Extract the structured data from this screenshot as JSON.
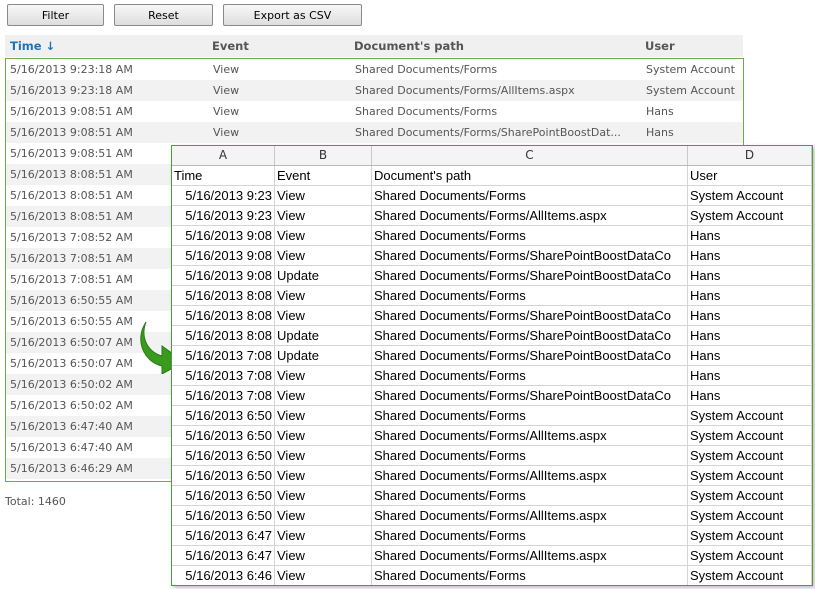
{
  "toolbar": {
    "filter_label": "Filter",
    "reset_label": "Reset",
    "export_label": "Export as CSV"
  },
  "log": {
    "headers": {
      "time": "Time ↓",
      "event": "Event",
      "path": "Document's path",
      "user": "User"
    },
    "rows": [
      {
        "time": "5/16/2013 9:23:18 AM",
        "event": "View",
        "path": "Shared Documents/Forms",
        "user": "System Account"
      },
      {
        "time": "5/16/2013 9:23:18 AM",
        "event": "View",
        "path": "Shared Documents/Forms/AllItems.aspx",
        "user": "System Account"
      },
      {
        "time": "5/16/2013 9:08:51 AM",
        "event": "View",
        "path": "Shared Documents/Forms",
        "user": "Hans"
      },
      {
        "time": "5/16/2013 9:08:51 AM",
        "event": "View",
        "path": "Shared Documents/Forms/SharePointBoostDat...",
        "user": "Hans"
      },
      {
        "time": "5/16/2013 9:08:51 AM",
        "event": "",
        "path": "",
        "user": ""
      },
      {
        "time": "5/16/2013 8:08:51 AM",
        "event": "",
        "path": "",
        "user": ""
      },
      {
        "time": "5/16/2013 8:08:51 AM",
        "event": "",
        "path": "",
        "user": ""
      },
      {
        "time": "5/16/2013 8:08:51 AM",
        "event": "",
        "path": "",
        "user": ""
      },
      {
        "time": "5/16/2013 7:08:52 AM",
        "event": "",
        "path": "",
        "user": ""
      },
      {
        "time": "5/16/2013 7:08:51 AM",
        "event": "",
        "path": "",
        "user": ""
      },
      {
        "time": "5/16/2013 7:08:51 AM",
        "event": "",
        "path": "",
        "user": ""
      },
      {
        "time": "5/16/2013 6:50:55 AM",
        "event": "",
        "path": "",
        "user": ""
      },
      {
        "time": "5/16/2013 6:50:55 AM",
        "event": "",
        "path": "",
        "user": ""
      },
      {
        "time": "5/16/2013 6:50:07 AM",
        "event": "",
        "path": "",
        "user": ""
      },
      {
        "time": "5/16/2013 6:50:07 AM",
        "event": "",
        "path": "",
        "user": ""
      },
      {
        "time": "5/16/2013 6:50:02 AM",
        "event": "",
        "path": "",
        "user": ""
      },
      {
        "time": "5/16/2013 6:50:02 AM",
        "event": "",
        "path": "",
        "user": ""
      },
      {
        "time": "5/16/2013 6:47:40 AM",
        "event": "",
        "path": "",
        "user": ""
      },
      {
        "time": "5/16/2013 6:47:40 AM",
        "event": "",
        "path": "",
        "user": ""
      },
      {
        "time": "5/16/2013 6:46:29 AM",
        "event": "",
        "path": "",
        "user": ""
      }
    ],
    "total_text": "Total: 1460"
  },
  "arrow_icon": "curved-arrow-icon",
  "arrow_color": "#3a9a1e",
  "spreadsheet": {
    "columns": [
      "A",
      "B",
      "C",
      "D"
    ],
    "header": {
      "time": "Time",
      "event": "Event",
      "path": "Document's path",
      "user": "User"
    },
    "rows": [
      {
        "time": "5/16/2013 9:23",
        "event": "View",
        "path": "Shared Documents/Forms",
        "user": "System Account"
      },
      {
        "time": "5/16/2013 9:23",
        "event": "View",
        "path": "Shared Documents/Forms/AllItems.aspx",
        "user": "System Account"
      },
      {
        "time": "5/16/2013 9:08",
        "event": "View",
        "path": "Shared Documents/Forms",
        "user": "Hans"
      },
      {
        "time": "5/16/2013 9:08",
        "event": "View",
        "path": "Shared Documents/Forms/SharePointBoostDataCo",
        "user": "Hans"
      },
      {
        "time": "5/16/2013 9:08",
        "event": "Update",
        "path": "Shared Documents/Forms/SharePointBoostDataCo",
        "user": "Hans"
      },
      {
        "time": "5/16/2013 8:08",
        "event": "View",
        "path": "Shared Documents/Forms",
        "user": "Hans"
      },
      {
        "time": "5/16/2013 8:08",
        "event": "View",
        "path": "Shared Documents/Forms/SharePointBoostDataCo",
        "user": "Hans"
      },
      {
        "time": "5/16/2013 8:08",
        "event": "Update",
        "path": "Shared Documents/Forms/SharePointBoostDataCo",
        "user": "Hans"
      },
      {
        "time": "5/16/2013 7:08",
        "event": "Update",
        "path": "Shared Documents/Forms/SharePointBoostDataCo",
        "user": "Hans"
      },
      {
        "time": "5/16/2013 7:08",
        "event": "View",
        "path": "Shared Documents/Forms",
        "user": "Hans"
      },
      {
        "time": "5/16/2013 7:08",
        "event": "View",
        "path": "Shared Documents/Forms/SharePointBoostDataCo",
        "user": "Hans"
      },
      {
        "time": "5/16/2013 6:50",
        "event": "View",
        "path": "Shared Documents/Forms",
        "user": "System Account"
      },
      {
        "time": "5/16/2013 6:50",
        "event": "View",
        "path": "Shared Documents/Forms/AllItems.aspx",
        "user": "System Account"
      },
      {
        "time": "5/16/2013 6:50",
        "event": "View",
        "path": "Shared Documents/Forms",
        "user": "System Account"
      },
      {
        "time": "5/16/2013 6:50",
        "event": "View",
        "path": "Shared Documents/Forms/AllItems.aspx",
        "user": "System Account"
      },
      {
        "time": "5/16/2013 6:50",
        "event": "View",
        "path": "Shared Documents/Forms",
        "user": "System Account"
      },
      {
        "time": "5/16/2013 6:50",
        "event": "View",
        "path": "Shared Documents/Forms/AllItems.aspx",
        "user": "System Account"
      },
      {
        "time": "5/16/2013 6:47",
        "event": "View",
        "path": "Shared Documents/Forms",
        "user": "System Account"
      },
      {
        "time": "5/16/2013 6:47",
        "event": "View",
        "path": "Shared Documents/Forms/AllItems.aspx",
        "user": "System Account"
      },
      {
        "time": "5/16/2013 6:46",
        "event": "View",
        "path": "Shared Documents/Forms",
        "user": "System Account"
      }
    ]
  }
}
